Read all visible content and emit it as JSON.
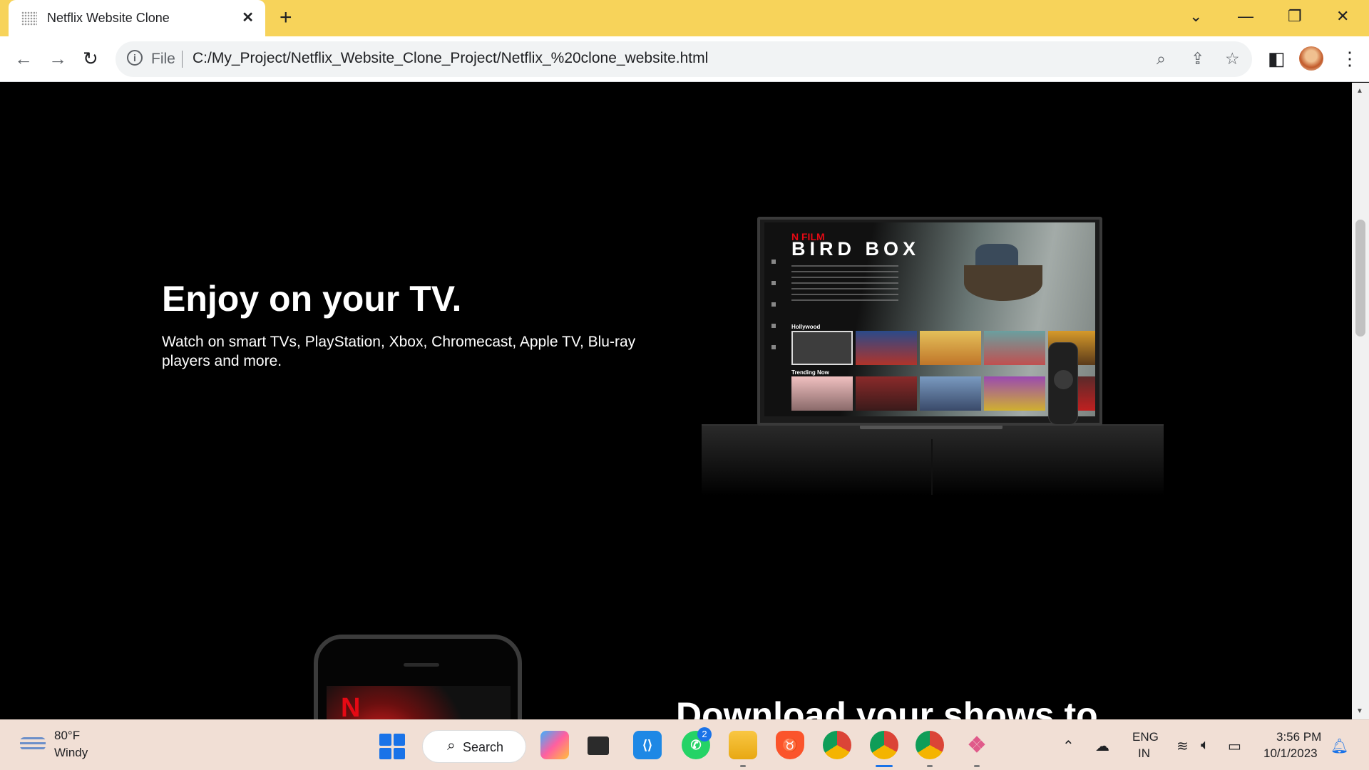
{
  "browser": {
    "tab_title": "Netflix Website Clone",
    "tab_close": "✕",
    "new_tab": "+",
    "omnibox_scheme": "File",
    "url": "C:/My_Project/Netflix_Website_Clone_Project/Netflix_%20clone_website.html"
  },
  "page": {
    "tv_section": {
      "title": "Enjoy on your TV.",
      "subtitle": "Watch on smart TVs, PlayStation, Xbox, Chromecast, Apple TV, Blu-ray players and more."
    },
    "tv_screen": {
      "brand": "N FILM",
      "show_title": "BIRD BOX",
      "row1_label": "Hollywood",
      "row2_label": "Trending Now"
    },
    "download_section": {
      "title": "Download your shows to"
    }
  },
  "taskbar": {
    "weather_temp": "80°F",
    "weather_desc": "Windy",
    "search_label": "Search",
    "whatsapp_badge": "2",
    "lang_line1": "ENG",
    "lang_line2": "IN",
    "time": "3:56 PM",
    "date": "10/1/2023"
  },
  "colors": {
    "tabstrip": "#f7d35a",
    "netflix_red": "#e50914",
    "taskbar": "#f1dfd5"
  }
}
